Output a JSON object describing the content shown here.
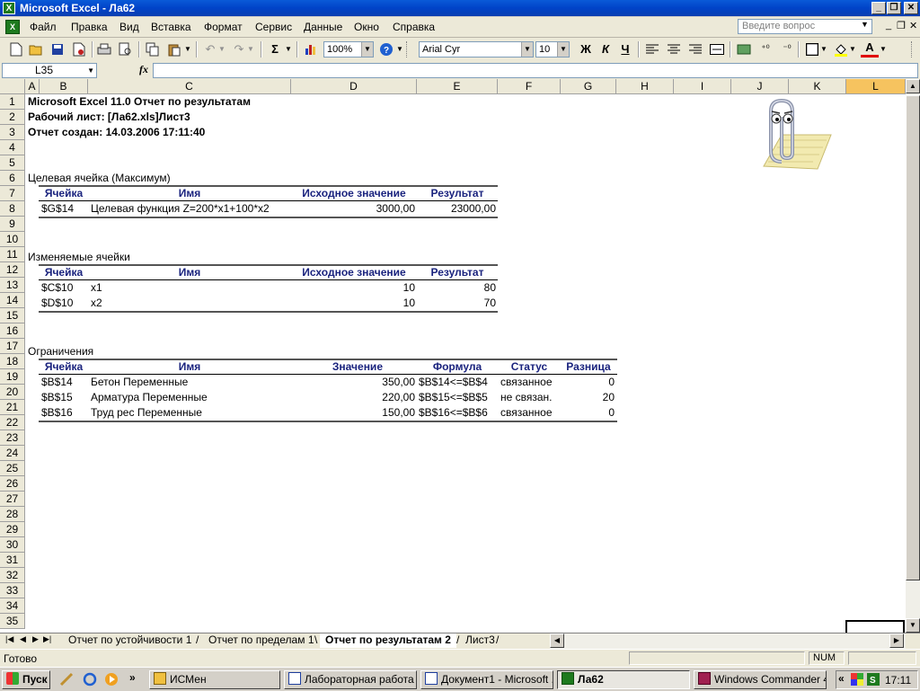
{
  "window": {
    "app_icon": "X",
    "title": "Microsoft Excel - Ла62",
    "minimize": "_",
    "restore": "❐",
    "close": "✕"
  },
  "menu": {
    "doc_icon": "X",
    "items": [
      "Файл",
      "Правка",
      "Вид",
      "Вставка",
      "Формат",
      "Сервис",
      "Данные",
      "Окно",
      "Справка"
    ],
    "ask_placeholder": "Введите вопрос",
    "doc_minimize": "_",
    "doc_restore": "❐",
    "doc_close": "✕"
  },
  "toolbar": {
    "zoom": "100%",
    "font_name": "Arial Cyr",
    "font_size": "10",
    "bold": "Ж",
    "italic": "К",
    "underline": "Ч",
    "autosum": "Σ",
    "font_color": "A"
  },
  "formula_bar": {
    "name_box": "L35",
    "fx": "fx",
    "value": ""
  },
  "columns": [
    "A",
    "B",
    "C",
    "D",
    "E",
    "F",
    "G",
    "H",
    "I",
    "J",
    "K",
    "L"
  ],
  "selected_column": "L",
  "rows": [
    "1",
    "2",
    "3",
    "4",
    "5",
    "6",
    "7",
    "8",
    "9",
    "10",
    "11",
    "12",
    "13",
    "14",
    "15",
    "16",
    "17",
    "18",
    "19",
    "20",
    "21",
    "22",
    "23",
    "24",
    "25",
    "26",
    "27",
    "28",
    "29",
    "30",
    "31",
    "32",
    "33",
    "34",
    "35"
  ],
  "report": {
    "line1": "Microsoft Excel 11.0 Отчет по результатам",
    "line2": "Рабочий лист: [Ла62.xls]Лист3",
    "line3": "Отчет создан: 14.03.2006 17:11:40",
    "target": {
      "section": "Целевая ячейка (Максимум)",
      "headers": [
        "Ячейка",
        "Имя",
        "Исходное значение",
        "Результат"
      ],
      "row": [
        "$G$14",
        "Целевая функция Z=200*x1+100*x2",
        "3000,00",
        "23000,00"
      ]
    },
    "variables": {
      "section": "Изменяемые ячейки",
      "headers": [
        "Ячейка",
        "Имя",
        "Исходное значение",
        "Результат"
      ],
      "rows": [
        [
          "$C$10",
          "x1",
          "10",
          "80"
        ],
        [
          "$D$10",
          "x2",
          "10",
          "70"
        ]
      ]
    },
    "constraints": {
      "section": "Ограничения",
      "headers": [
        "Ячейка",
        "Имя",
        "Значение",
        "Формула",
        "Статус",
        "Разница"
      ],
      "rows": [
        [
          "$B$14",
          "Бетон Переменные",
          "350,00",
          "$B$14<=$B$4",
          "связанное",
          "0"
        ],
        [
          "$B$15",
          "Арматура Переменные",
          "220,00",
          "$B$15<=$B$5",
          "не связан.",
          "20"
        ],
        [
          "$B$16",
          "Труд рес Переменные",
          "150,00",
          "$B$16<=$B$6",
          "связанное",
          "0"
        ]
      ]
    }
  },
  "sheet_tabs": [
    "Отчет по устойчивости 1",
    "Отчет по пределам 1",
    "Отчет по результатам 2",
    "Лист3"
  ],
  "active_tab": "Отчет по результатам 2",
  "status": {
    "ready": "Готово",
    "num": "NUM"
  },
  "taskbar": {
    "start": "Пуск",
    "more": "»",
    "buttons": [
      {
        "label": "ИСМен",
        "icon": "folder-icon"
      },
      {
        "label": "Лабораторная работа ...",
        "icon": "word-doc-icon"
      },
      {
        "label": "Документ1 - Microsoft ...",
        "icon": "word-doc-icon"
      },
      {
        "label": "Ла62",
        "icon": "excel-icon",
        "active": true
      },
      {
        "label": "Windows Commander 4...",
        "icon": "commander-icon"
      }
    ],
    "tray_arrow": "«",
    "clock": "17:11"
  },
  "colors": {
    "title_bar": "#0043c8",
    "header_text": "#1a237e",
    "selected_col": "#f6c35f"
  }
}
